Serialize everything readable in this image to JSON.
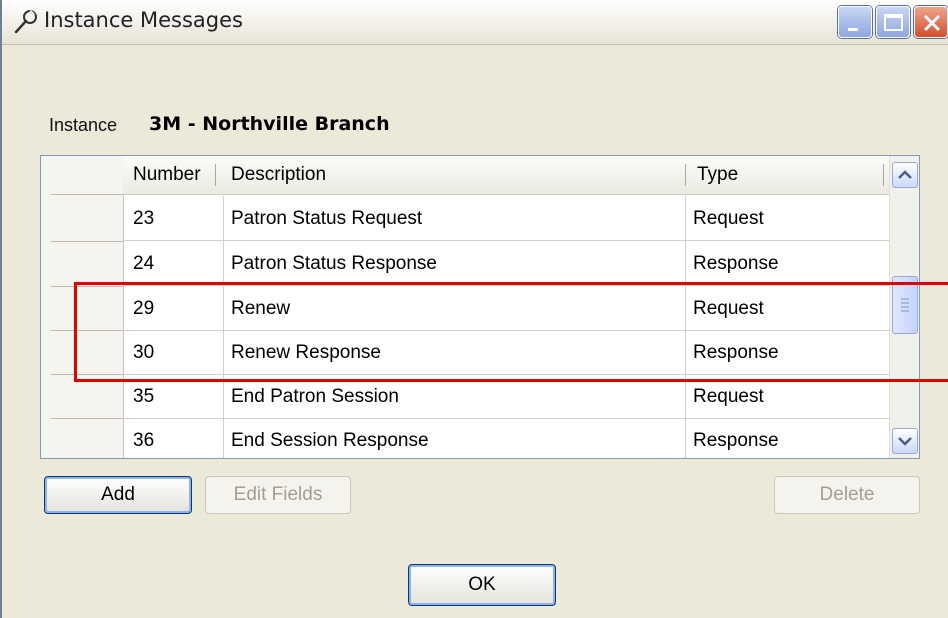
{
  "window": {
    "title": "Instance Messages",
    "icon": "wrench-icon",
    "controls": [
      "minimize-icon",
      "maximize-icon",
      "close-icon"
    ]
  },
  "instance": {
    "label": "Instance",
    "value": "3M - Northville Branch"
  },
  "grid": {
    "columns": [
      "Number",
      "Description",
      "Type"
    ],
    "rows": [
      {
        "number": "23",
        "description": "Patron Status Request",
        "type": "Request"
      },
      {
        "number": "24",
        "description": "Patron Status Response",
        "type": "Response"
      },
      {
        "number": "29",
        "description": "Renew",
        "type": "Request"
      },
      {
        "number": "30",
        "description": "Renew Response",
        "type": "Response"
      },
      {
        "number": "35",
        "description": "End Patron Session",
        "type": "Request"
      },
      {
        "number": "36",
        "description": "End Session Response",
        "type": "Response"
      }
    ]
  },
  "buttons": {
    "add": "Add",
    "edit_fields": "Edit Fields",
    "delete": "Delete",
    "ok": "OK"
  },
  "colors": {
    "highlight": "#e30000",
    "window_bg": "#ece9d8"
  }
}
